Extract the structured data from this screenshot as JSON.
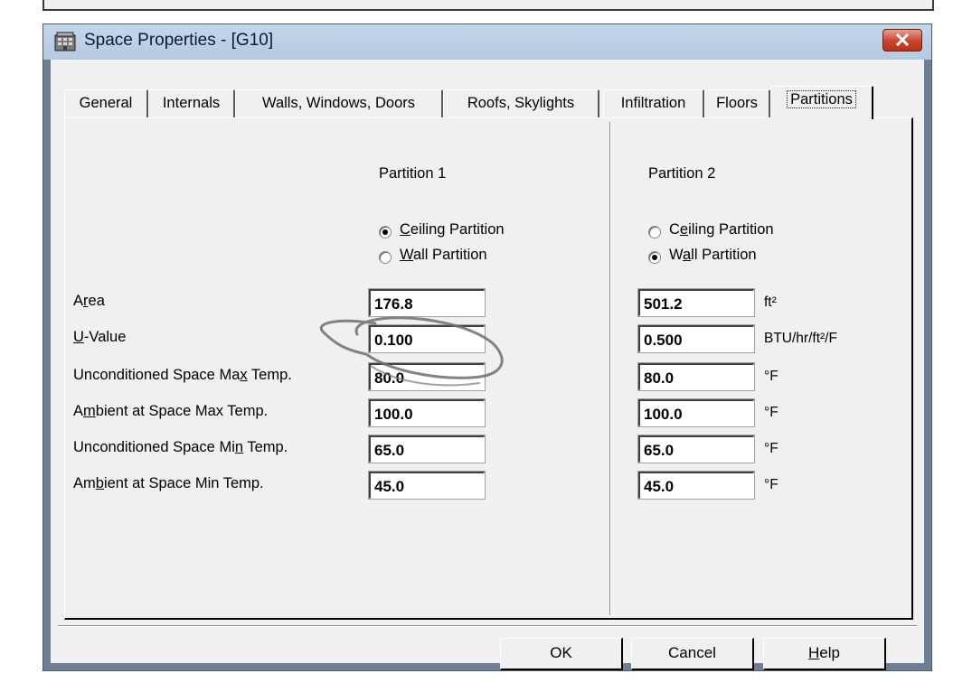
{
  "window": {
    "title": "Space Properties - [G10]"
  },
  "tabs": [
    {
      "label": "General"
    },
    {
      "label": "Internals"
    },
    {
      "label": "Walls, Windows, Doors"
    },
    {
      "label": "Roofs, Skylights"
    },
    {
      "label": "Infiltration"
    },
    {
      "label": "Floors"
    },
    {
      "label": "Partitions",
      "active": true
    }
  ],
  "partition1": {
    "header": "Partition 1",
    "ceiling_option": {
      "pre": "",
      "key": "C",
      "post": "eiling Partition",
      "selected": true
    },
    "wall_option": {
      "pre": "",
      "key": "W",
      "post": "all Partition",
      "selected": false
    },
    "values": {
      "area": "176.8",
      "u_value": "0.100",
      "max_temp": "80.0",
      "ambient_max": "100.0",
      "min_temp": "65.0",
      "ambient_min": "45.0"
    }
  },
  "partition2": {
    "header": "Partition 2",
    "ceiling_option": {
      "pre": "C",
      "key": "e",
      "post": "iling Partition",
      "selected": false
    },
    "wall_option": {
      "pre": "W",
      "key": "a",
      "post": "ll Partition",
      "selected": true
    },
    "values": {
      "area": "501.2",
      "u_value": "0.500",
      "max_temp": "80.0",
      "ambient_max": "100.0",
      "min_temp": "65.0",
      "ambient_min": "45.0"
    }
  },
  "labels": {
    "area": {
      "pre": "A",
      "key": "r",
      "post": "ea"
    },
    "u_value": {
      "pre": "",
      "key": "U",
      "post": "-Value"
    },
    "max_temp": {
      "pre": "Unconditioned Space Ma",
      "key": "x",
      "post": " Temp."
    },
    "ambient_max": {
      "pre": "A",
      "key": "m",
      "post": "bient at Space Max Temp."
    },
    "min_temp": {
      "pre": "Unconditioned Space Mi",
      "key": "n",
      "post": " Temp."
    },
    "ambient_min": {
      "pre": "Am",
      "key": "b",
      "post": "ient at Space Min Temp."
    }
  },
  "units": {
    "area": "ft²",
    "u_value": "BTU/hr/ft²/F",
    "max_temp": "°F",
    "ambient_max": "°F",
    "min_temp": "°F",
    "ambient_min": "°F"
  },
  "buttons": {
    "ok": {
      "pre": "OK",
      "key": "",
      "post": ""
    },
    "cancel": {
      "pre": "Cancel",
      "key": "",
      "post": ""
    },
    "help": {
      "pre": "",
      "key": "H",
      "post": "elp"
    }
  },
  "icons": {
    "app": "building-icon",
    "close": "close-icon"
  },
  "colors": {
    "close_button": "#c7442c",
    "titlebar": "#bfd1e7",
    "annotation": "#6f6f6f"
  }
}
